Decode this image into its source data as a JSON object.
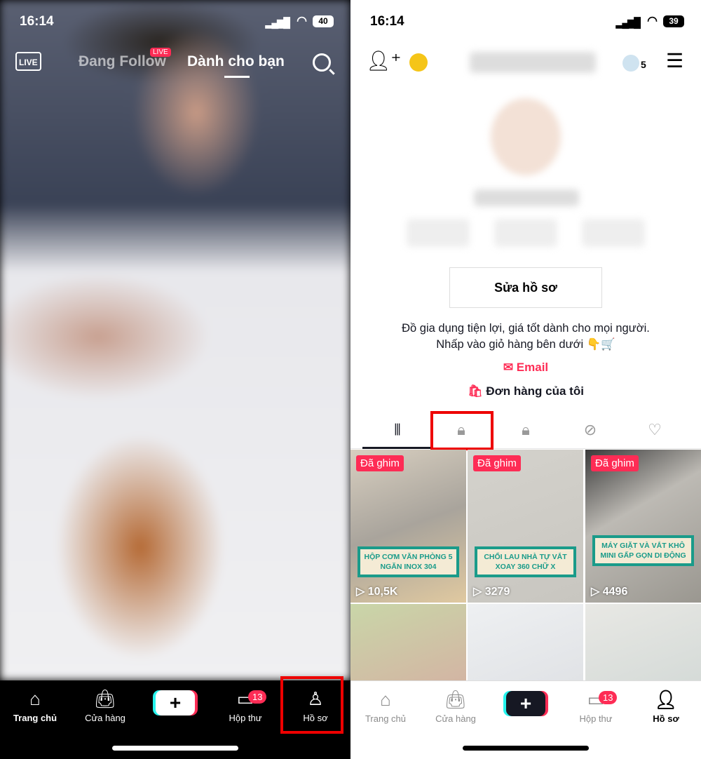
{
  "left": {
    "status": {
      "time": "16:14",
      "battery": "40"
    },
    "topnav": {
      "live_icon_label": "LIVE",
      "following": "Đang Follow",
      "live_badge": "LIVE",
      "for_you": "Dành cho bạn"
    },
    "tabbar": [
      {
        "label": "Trang chủ",
        "icon": "home-icon"
      },
      {
        "label": "Cửa hàng",
        "icon": "shopping-bag-icon"
      },
      {
        "label": "+",
        "icon": "plus-icon"
      },
      {
        "label": "Hộp thư",
        "icon": "inbox-icon",
        "badge": "13"
      },
      {
        "label": "Hồ sơ",
        "icon": "profile-icon"
      }
    ]
  },
  "right": {
    "status": {
      "time": "16:14",
      "battery": "39"
    },
    "header": {
      "friends_count": "5"
    },
    "edit_profile": "Sửa hồ sơ",
    "bio": [
      "Đồ gia dụng tiện lợi, giá tốt dành cho mọi người.",
      "Nhấp vào giỏ hàng bên dưới 👇🛒"
    ],
    "email": "Email",
    "orders": "Đơn hàng của tôi",
    "content_tabs": [
      "videos-grid-icon",
      "shop-bag-icon",
      "lock-icon",
      "hidden-eye-icon",
      "liked-heart-icon"
    ],
    "videos": [
      {
        "pinned": "Đã ghim",
        "caption_plain": "HỘP CƠM VĂN PHÒNG 5 NGĂN ",
        "caption_bold": "INOX 304",
        "views": "10,5K"
      },
      {
        "pinned": "Đã ghim",
        "caption_plain": "CHỔI LAU NHÀ TỰ VẮT XOAY 360 CHỮ X",
        "caption_bold": "",
        "views": "3279"
      },
      {
        "pinned": "Đã ghim",
        "caption_plain": "MÁY GIẶT VÀ VẮT KHÔ MINI GẤP GỌN DI ĐỘNG",
        "caption_bold": "",
        "views": "4496"
      }
    ],
    "tabbar": [
      {
        "label": "Trang chủ"
      },
      {
        "label": "Cửa hàng"
      },
      {
        "label": "+"
      },
      {
        "label": "Hộp thư",
        "badge": "13"
      },
      {
        "label": "Hồ sơ"
      }
    ]
  },
  "colors": {
    "accent": "#fe2c55",
    "highlight": "#e00000",
    "caption": "#1a9b8a"
  }
}
